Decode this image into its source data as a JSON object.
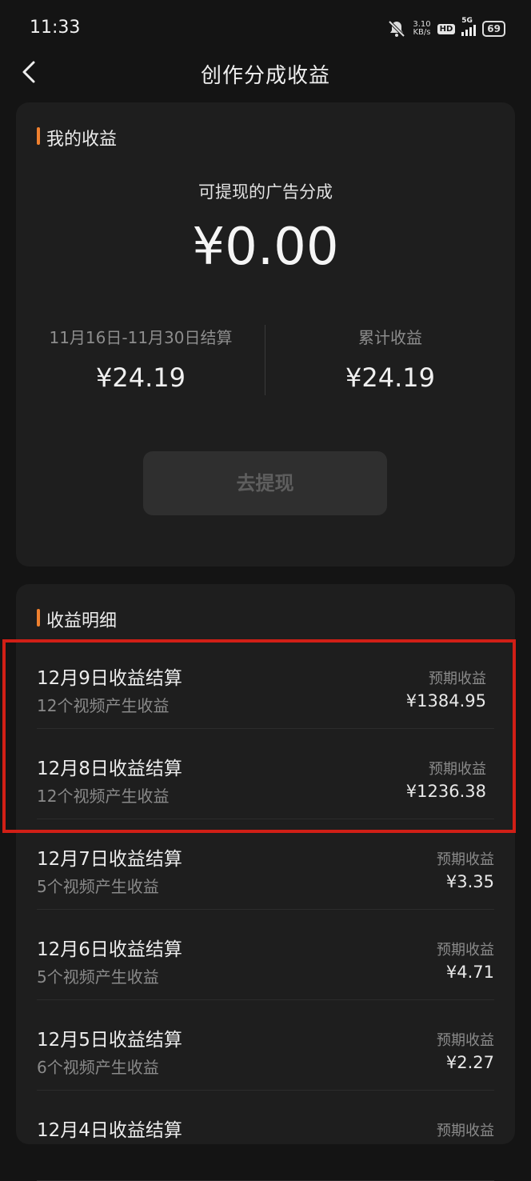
{
  "status": {
    "time": "11:33",
    "net_speed_value": "3.10",
    "net_speed_unit": "KB/s",
    "hd": "HD",
    "network": "5G",
    "battery": "69"
  },
  "nav": {
    "title": "创作分成收益"
  },
  "earnings": {
    "section_title": "我的收益",
    "withdrawable_label": "可提现的广告分成",
    "withdrawable_amount": "¥0.00",
    "period_label": "11月16日-11月30日结算",
    "period_amount": "¥24.19",
    "total_label": "累计收益",
    "total_amount": "¥24.19",
    "withdraw_button": "去提现"
  },
  "details": {
    "section_title": "收益明细",
    "rows": [
      {
        "title": "12月9日收益结算",
        "sub": "12个视频产生收益",
        "label": "预期收益",
        "amount": "¥1384.95"
      },
      {
        "title": "12月8日收益结算",
        "sub": "12个视频产生收益",
        "label": "预期收益",
        "amount": "¥1236.38"
      },
      {
        "title": "12月7日收益结算",
        "sub": "5个视频产生收益",
        "label": "预期收益",
        "amount": "¥3.35"
      },
      {
        "title": "12月6日收益结算",
        "sub": "5个视频产生收益",
        "label": "预期收益",
        "amount": "¥4.71"
      },
      {
        "title": "12月5日收益结算",
        "sub": "6个视频产生收益",
        "label": "预期收益",
        "amount": "¥2.27"
      },
      {
        "title": "12月4日收益结算",
        "sub": "",
        "label": "预期收益",
        "amount": ""
      }
    ]
  },
  "colors": {
    "accent": "#f0812f",
    "highlight": "#d11f16",
    "background": "#141414",
    "card": "#1e1e1e"
  }
}
